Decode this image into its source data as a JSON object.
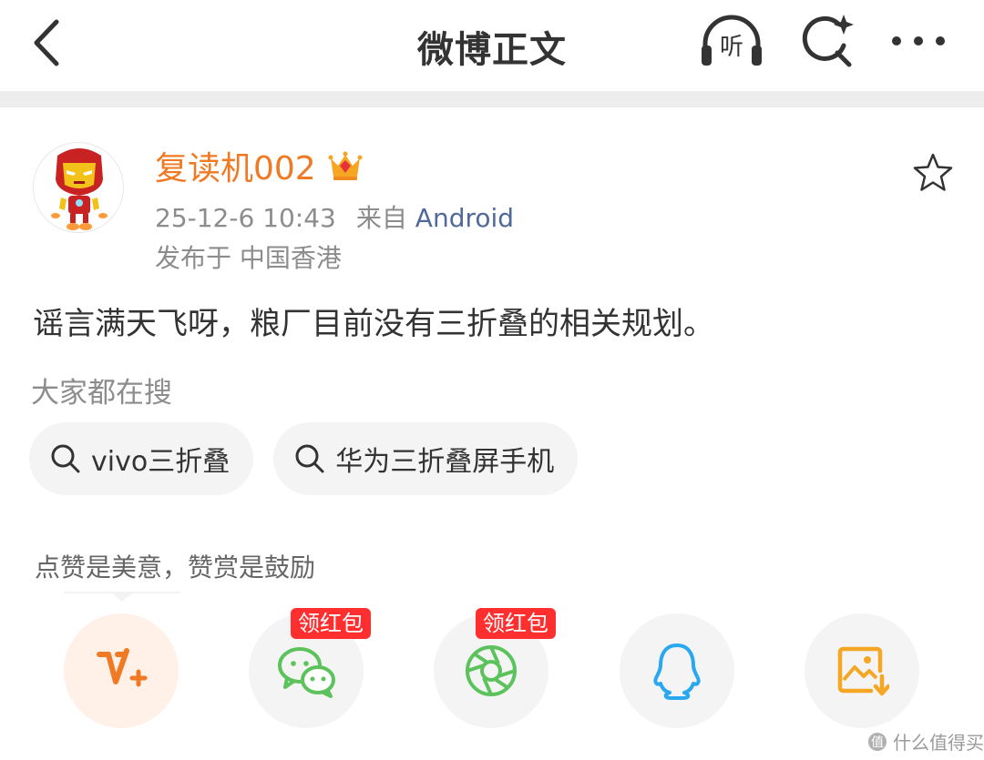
{
  "header": {
    "title": "微博正文",
    "listen_label": "听",
    "icons": {
      "back": "chevron-left-icon",
      "listen": "headphones-icon",
      "search": "search-sparkle-icon",
      "more": "more-dots-icon"
    }
  },
  "post": {
    "username": "复读机002",
    "timestamp": "25-12-6 10:43",
    "source_prefix": "来自",
    "source": "Android",
    "location": "发布于 中国香港",
    "content": "谣言满天飞呀，粮厂目前没有三折叠的相关规划。"
  },
  "search": {
    "title": "大家都在搜",
    "chips": [
      "vivo三折叠",
      "华为三折叠屏手机"
    ]
  },
  "reward": {
    "hint": "点赞是美意，赞赏是鼓励"
  },
  "share": {
    "wechat_badge": "领红包",
    "moments_badge": "领红包"
  },
  "colors": {
    "accent_orange": "#f07a23",
    "link_blue": "#50689a",
    "badge_red": "#ff2f2f",
    "wechat_green": "#5cc35c",
    "qq_blue": "#29a8f0",
    "save_orange": "#f5a623"
  },
  "watermark": "什么值得买"
}
